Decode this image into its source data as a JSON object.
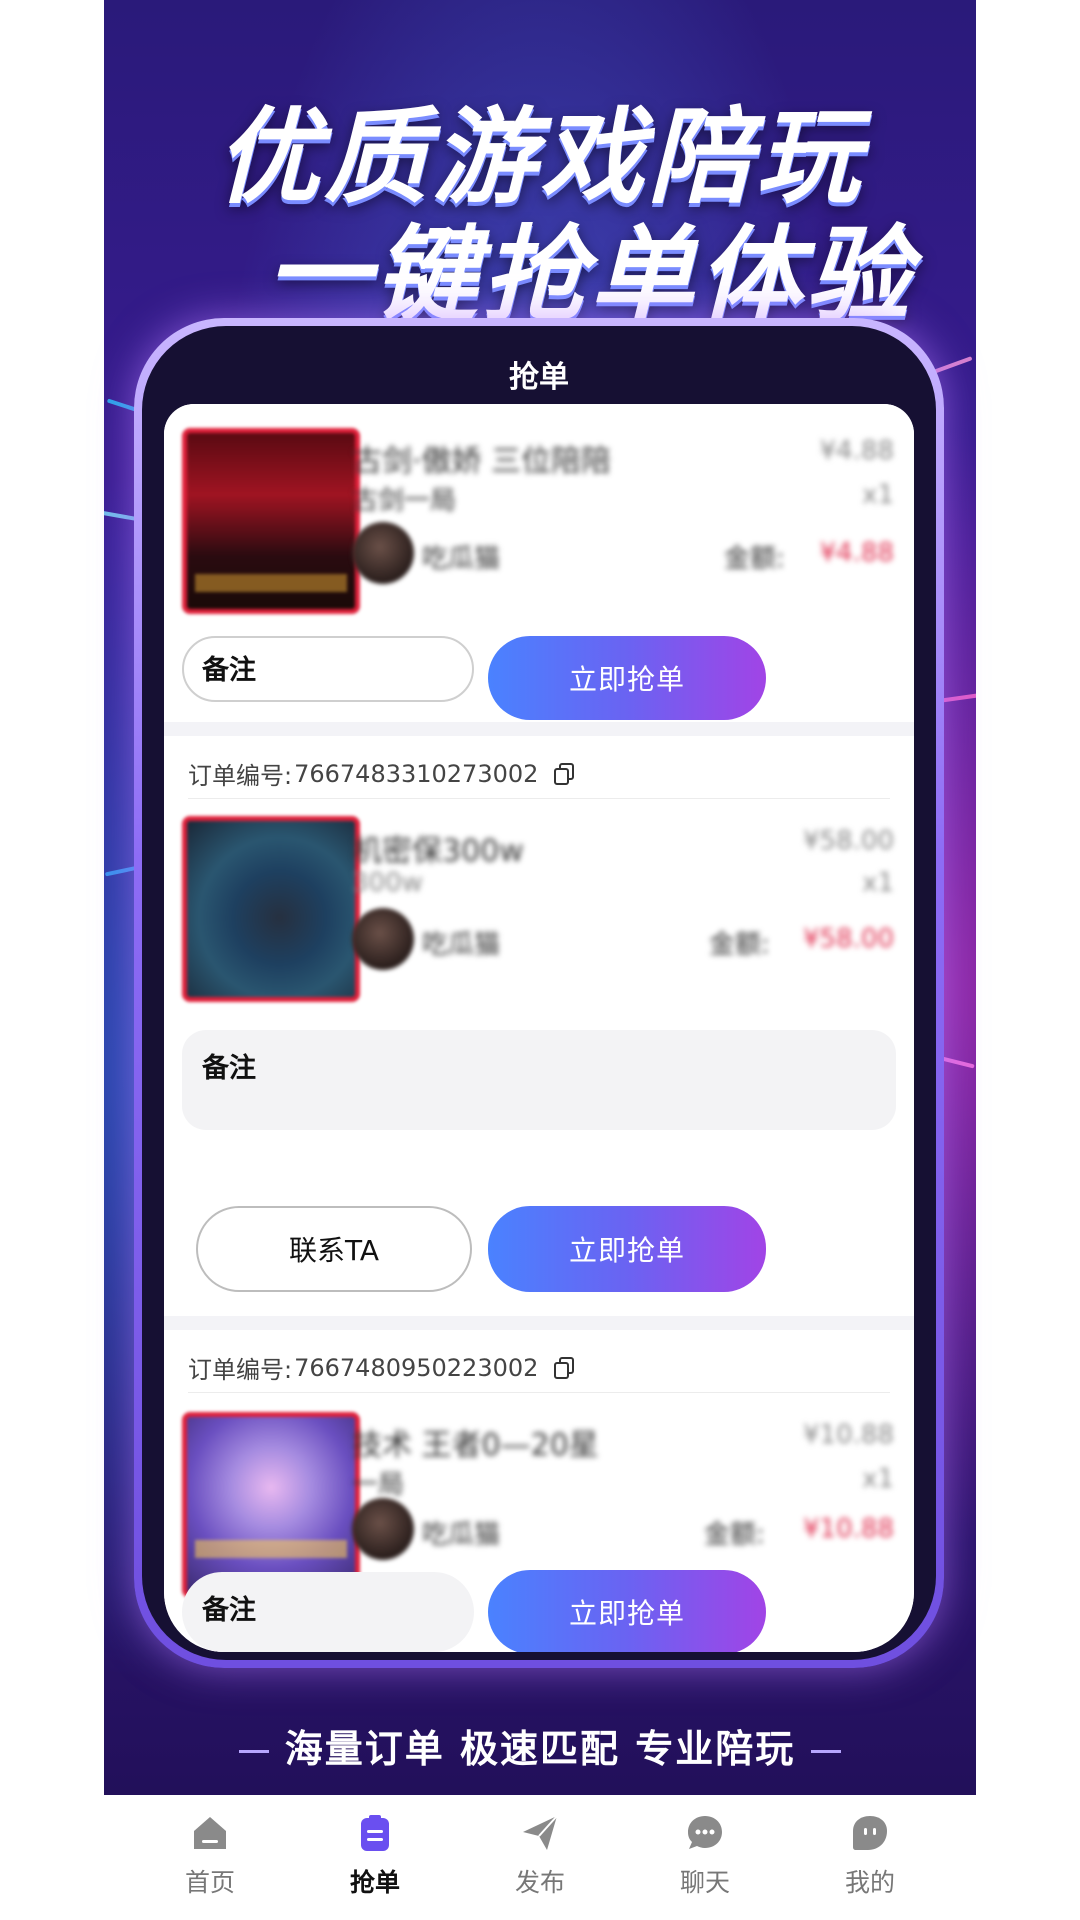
{
  "poster": {
    "headline_line1": "优质游戏陪玩",
    "headline_line2": "一键抢单体验",
    "slogan": "海量订单 极速匹配 专业陪玩"
  },
  "screen": {
    "title": "抢单"
  },
  "orders": [
    {
      "order_label": "",
      "order_no": "",
      "title": "古剑·傲娇 三位陪陪",
      "subtitle": "古剑一局",
      "price": "¥4.88",
      "qty": "x1",
      "user": "吃瓜猫",
      "amount_label": "金额:",
      "amount": "¥4.88",
      "remark": "备注",
      "grab": "立即抢单"
    },
    {
      "order_label": "订单编号:",
      "order_no": "7667483310273002",
      "title": "机密保300w",
      "subtitle": "300w",
      "price": "¥58.00",
      "qty": "x1",
      "user": "吃瓜猫",
      "amount_label": "金额:",
      "amount": "¥58.00",
      "remark": "备注",
      "contact": "联系TA",
      "grab": "立即抢单"
    },
    {
      "order_label": "订单编号:",
      "order_no": "7667480950223002",
      "title": "技术 王者0—20星",
      "subtitle": "一局",
      "price": "¥10.88",
      "qty": "x1",
      "user": "吃瓜猫",
      "amount_label": "金额:",
      "amount": "¥10.88",
      "remark": "备注",
      "grab": "立即抢单"
    }
  ],
  "tabbar": [
    {
      "label": "首页",
      "icon": "home-icon"
    },
    {
      "label": "抢单",
      "icon": "clipboard-icon"
    },
    {
      "label": "发布",
      "icon": "send-icon"
    },
    {
      "label": "聊天",
      "icon": "chat-icon"
    },
    {
      "label": "我的",
      "icon": "profile-icon"
    }
  ],
  "colors": {
    "accent": "#6a63f2",
    "price_red": "#e03050",
    "frame": "#8d6cf5"
  }
}
